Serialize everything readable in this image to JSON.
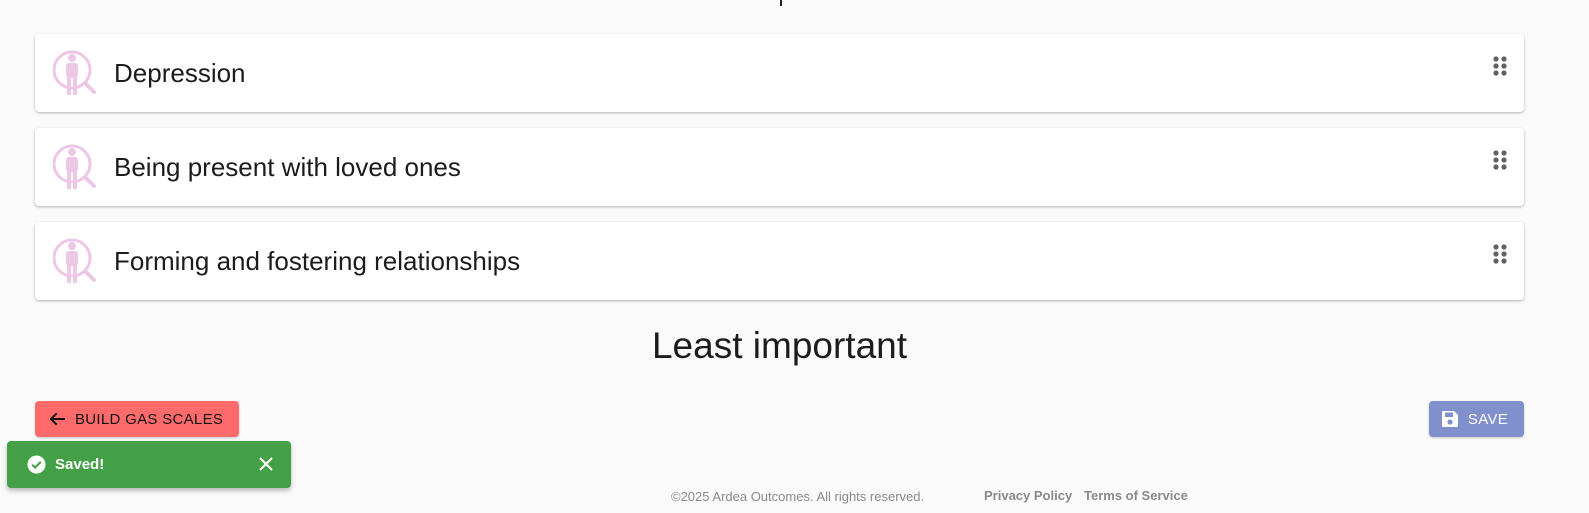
{
  "priorities": [
    {
      "label": "Depression",
      "icon": "person-search-icon"
    },
    {
      "label": "Being present with loved ones",
      "icon": "person-search-icon"
    },
    {
      "label": "Forming and fostering relationships",
      "icon": "person-search-icon"
    }
  ],
  "section_label_bottom": "Least important",
  "actions": {
    "back_label": "BUILD GAS SCALES",
    "back_icon": "arrow-left-icon",
    "save_label": "SAVE",
    "save_icon": "floppy-disk-icon"
  },
  "toast": {
    "message": "Saved!",
    "icon": "check-circle-icon",
    "close_icon": "close-icon"
  },
  "footer": {
    "copyright": "©2025 Ardea Outcomes. All rights reserved.",
    "privacy": "Privacy Policy",
    "terms": "Terms of Service"
  },
  "colors": {
    "back_button": "#ff6b6b",
    "save_button": "#7f90cc",
    "toast": "#43a047",
    "icon_tint": "#ecc8e4"
  }
}
